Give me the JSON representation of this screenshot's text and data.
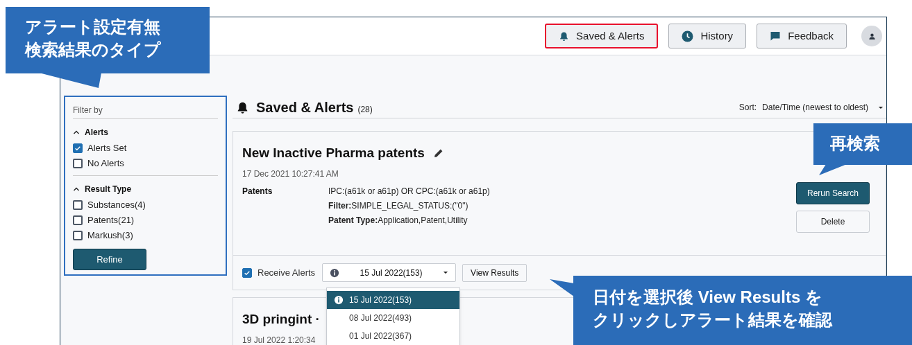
{
  "header": {
    "nav_buttons": [
      {
        "label": "Saved & Alerts",
        "selected": true
      },
      {
        "label": "History",
        "selected": false
      },
      {
        "label": "Feedback",
        "selected": false
      }
    ]
  },
  "filter": {
    "title": "Filter by",
    "groups": [
      {
        "label": "Alerts",
        "expanded": true,
        "options": [
          {
            "label": "Alerts Set",
            "checked": true
          },
          {
            "label": "No Alerts",
            "checked": false
          }
        ]
      },
      {
        "label": "Result Type",
        "expanded": true,
        "options": [
          {
            "label": "Substances(4)",
            "checked": false
          },
          {
            "label": "Patents(21)",
            "checked": false
          },
          {
            "label": "Markush(3)",
            "checked": false
          }
        ]
      }
    ],
    "button": "Refine"
  },
  "main": {
    "title": "Saved & Alerts",
    "count": "(28)",
    "sort_label": "Sort:",
    "sort_value": "Date/Time (newest to oldest)"
  },
  "cards": [
    {
      "title": "New Inactive Pharma patents",
      "date": "17 Dec 2021 10:27:41 AM",
      "source": "Patents",
      "query": [
        "IPC:(a61k or a61p) OR CPC:(a61k or a61p)",
        "**Filter:**SIMPLE_LEGAL_STATUS:(\"0\")",
        "**Patent Type:**Application,Patent,Utility"
      ],
      "buttons": [
        "Rerun Search",
        "Delete"
      ],
      "receive_alerts": {
        "label": "Receive Alerts",
        "checked": true
      },
      "date_select": "15 Jul 2022(153)",
      "view_button": "View Results"
    },
    {
      "title": "3D pringint ·",
      "date": "19 Jul 2022 1:20:34"
    }
  ],
  "dropdown": {
    "options": [
      {
        "label": "15 Jul 2022(153)",
        "selected": true
      },
      {
        "label": "08 Jul 2022(493)",
        "selected": false
      },
      {
        "label": "01 Jul 2022(367)",
        "selected": false
      }
    ]
  },
  "callouts": [
    {
      "lines": [
        "アラート設定有無",
        "検索結果のタイプ"
      ]
    },
    {
      "lines": [
        "再検索"
      ]
    },
    {
      "lines": [
        "日付を選択後 View Results を",
        "クリックしアラート結果を確認"
      ]
    }
  ]
}
